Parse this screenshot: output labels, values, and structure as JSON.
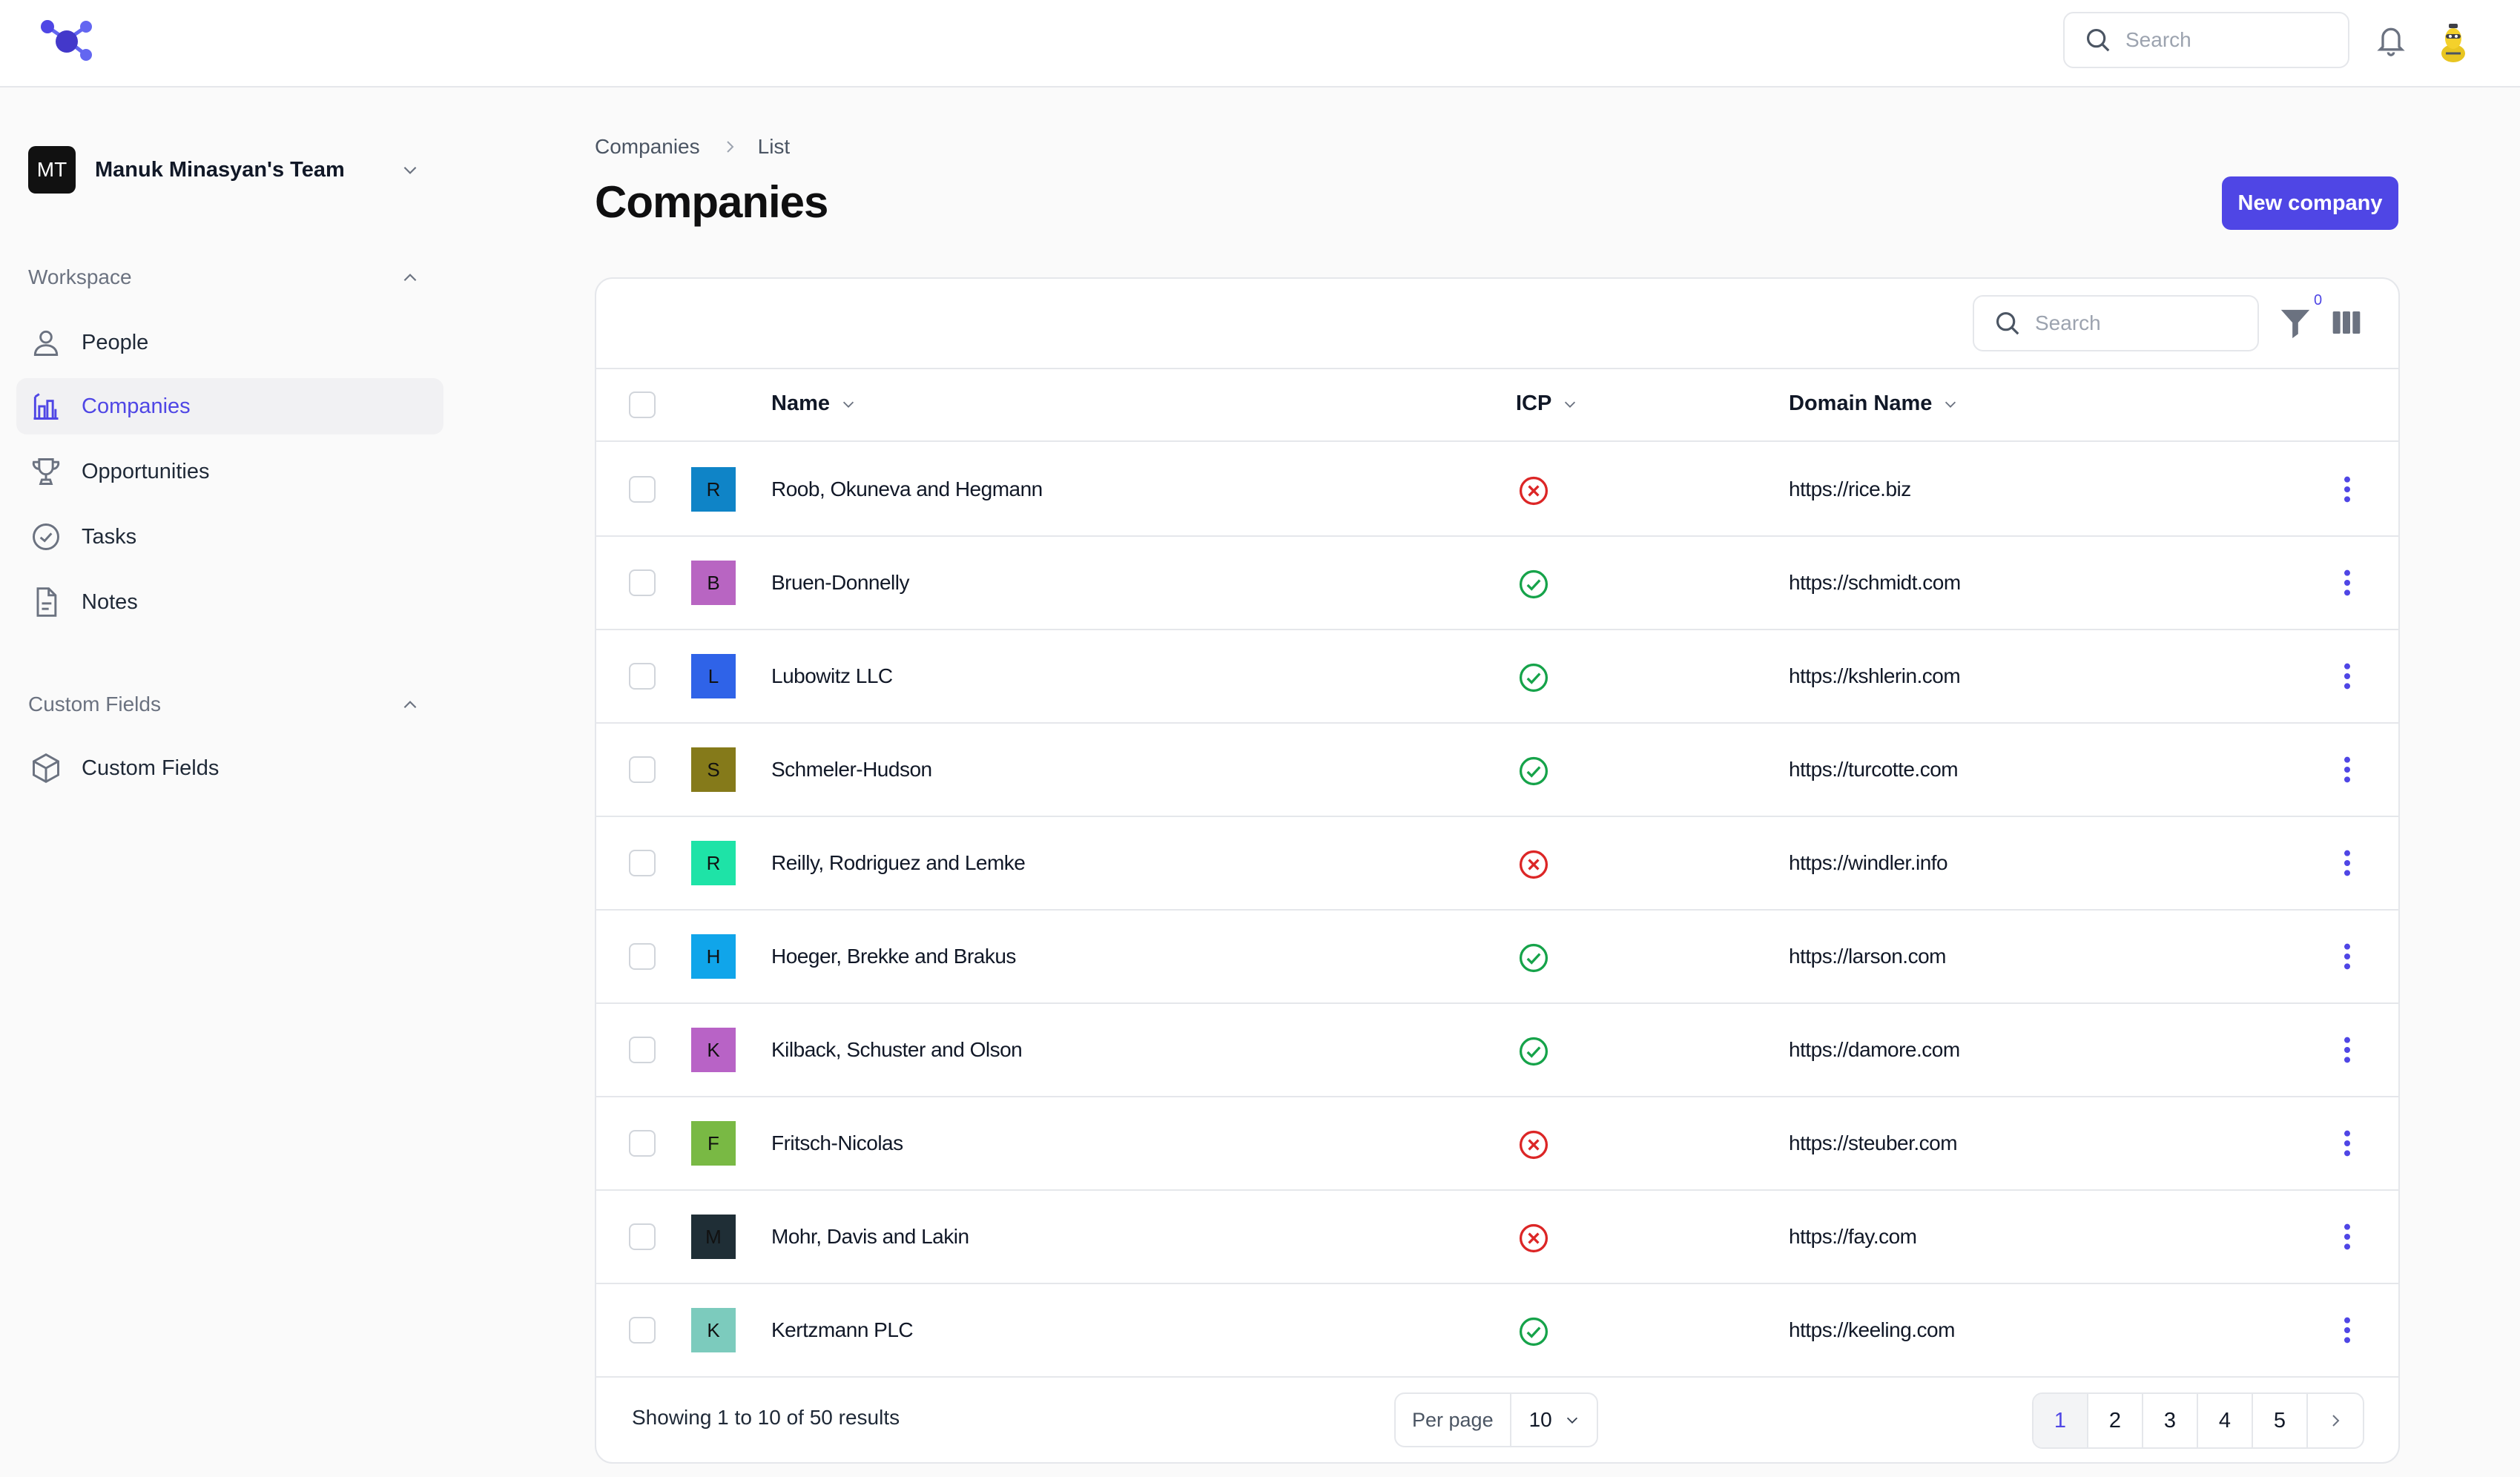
{
  "header": {
    "search_placeholder": "Search"
  },
  "sidebar": {
    "team": {
      "initials": "MT",
      "name": "Manuk Minasyan's Team"
    },
    "workspace_label": "Workspace",
    "items": [
      {
        "label": "People",
        "icon": "person-icon",
        "active": false
      },
      {
        "label": "Companies",
        "icon": "building-chart-icon",
        "active": true
      },
      {
        "label": "Opportunities",
        "icon": "trophy-icon",
        "active": false
      },
      {
        "label": "Tasks",
        "icon": "check-circle-icon",
        "active": false
      },
      {
        "label": "Notes",
        "icon": "document-icon",
        "active": false
      }
    ],
    "custom_fields_label": "Custom Fields",
    "custom_items": [
      {
        "label": "Custom Fields",
        "icon": "cube-icon"
      }
    ]
  },
  "main": {
    "breadcrumb": [
      "Companies",
      "List"
    ],
    "title": "Companies",
    "new_button": "New company"
  },
  "table": {
    "search_placeholder": "Search",
    "filter_count": "0",
    "columns": [
      "Name",
      "ICP",
      "Domain Name"
    ],
    "rows": [
      {
        "initial": "R",
        "color": "#0f84c7",
        "name": "Roob, Okuneva and Hegmann",
        "icp": false,
        "domain": "https://rice.biz"
      },
      {
        "initial": "B",
        "color": "#b865c2",
        "name": "Bruen-Donnelly",
        "icp": true,
        "domain": "https://schmidt.com"
      },
      {
        "initial": "L",
        "color": "#2f63e8",
        "name": "Lubowitz LLC",
        "icp": true,
        "domain": "https://kshlerin.com"
      },
      {
        "initial": "S",
        "color": "#857a1a",
        "name": "Schmeler-Hudson",
        "icp": true,
        "domain": "https://turcotte.com"
      },
      {
        "initial": "R",
        "color": "#1ee3a7",
        "name": "Reilly, Rodriguez and Lemke",
        "icp": false,
        "domain": "https://windler.info"
      },
      {
        "initial": "H",
        "color": "#10a5ea",
        "name": "Hoeger, Brekke and Brakus",
        "icp": true,
        "domain": "https://larson.com"
      },
      {
        "initial": "K",
        "color": "#b863c6",
        "name": "Kilback, Schuster and Olson",
        "icp": true,
        "domain": "https://damore.com"
      },
      {
        "initial": "F",
        "color": "#79b944",
        "name": "Fritsch-Nicolas",
        "icp": false,
        "domain": "https://steuber.com"
      },
      {
        "initial": "M",
        "color": "#1f2e36",
        "name": "Mohr, Davis and Lakin",
        "icp": false,
        "domain": "https://fay.com"
      },
      {
        "initial": "K",
        "color": "#7ccbbd",
        "name": "Kertzmann PLC",
        "icp": true,
        "domain": "https://keeling.com"
      }
    ],
    "footer": {
      "results": "Showing 1 to 10 of 50 results",
      "per_page_label": "Per page",
      "per_page_value": "10",
      "pages": [
        "1",
        "2",
        "3",
        "4",
        "5"
      ],
      "current_page": "1"
    }
  },
  "colors": {
    "accent": "#4f46e5",
    "icp_yes": "#16a34a",
    "icp_no": "#dc2626"
  }
}
